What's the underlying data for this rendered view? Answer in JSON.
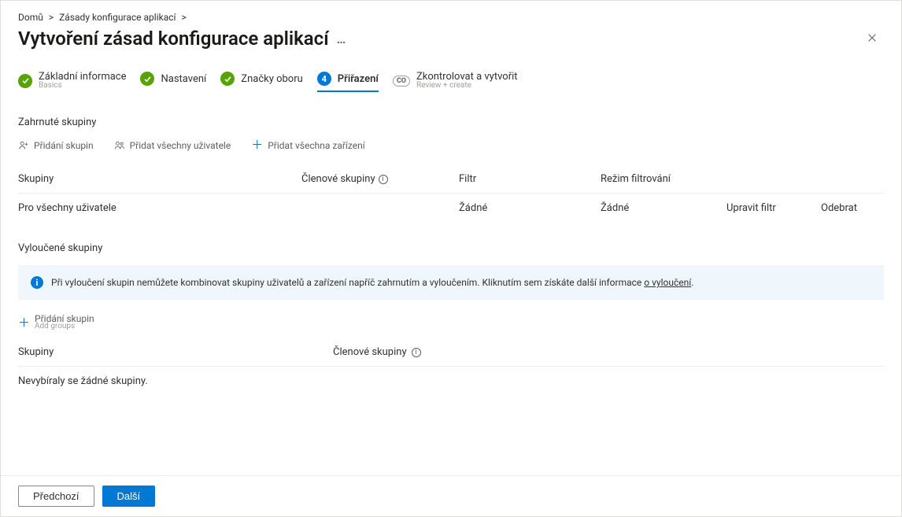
{
  "breadcrumb": {
    "home": "Domů",
    "sep": ">",
    "policies": "Zásady konfigurace aplikací",
    "sep2": ">"
  },
  "title": "Vytvoření zásad konfigurace aplikací",
  "steps": {
    "s1": {
      "label": "Základní informace",
      "sub": "Basics"
    },
    "s2": {
      "label": "Nastavení"
    },
    "s3": {
      "label": "Značky oboru"
    },
    "s4": {
      "num": "4",
      "label": "Přiřazení"
    },
    "s5": {
      "co": "CO",
      "label": "Zkontrolovat a vytvořit",
      "sub": "Review + create"
    }
  },
  "included": {
    "heading": "Zahrnuté skupiny",
    "toolbar": {
      "add_groups": "Přidání skupin",
      "add_all_users": "Přidat všechny uživatele",
      "add_all_devices": "Přidat všechna zařízení"
    },
    "columns": {
      "groups": "Skupiny",
      "members": "Členové skupiny",
      "filter": "Filtr",
      "filter_mode": "Režim filtrování"
    },
    "row": {
      "groups": "Pro všechny uživatele",
      "members": "",
      "filter": "Žádné",
      "filter_mode": "Žádné",
      "edit_filter": "Upravit filtr",
      "remove": "Odebrat"
    }
  },
  "excluded": {
    "heading": "Vyloučené skupiny",
    "info_text": "Při vyloučení skupin nemůžete kombinovat skupiny uživatelů a zařízení napříč zahrnutím a vyloučením. Kliknutím sem získáte další informace ",
    "info_link": "o vyloučení",
    "add_groups": "Přidání skupin",
    "add_groups_sub": "Add groups",
    "columns": {
      "groups": "Skupiny",
      "members": "Členové skupiny"
    },
    "empty": "Nevybíraly se žádné skupiny."
  },
  "footer": {
    "previous": "Předchozí",
    "next": "Další"
  }
}
